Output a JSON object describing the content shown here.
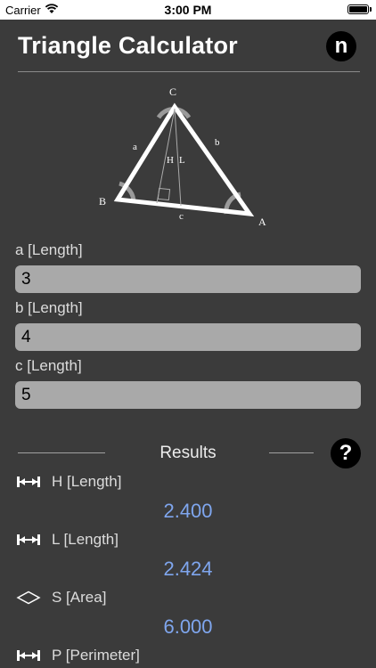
{
  "status_bar": {
    "carrier": "Carrier",
    "time": "3:00 PM"
  },
  "header": {
    "title": "Triangle Calculator",
    "info_button_label": "n"
  },
  "diagram": {
    "vertex_labels": {
      "a_vertex": "A",
      "b_vertex": "B",
      "c_vertex": "C"
    },
    "side_labels": {
      "a": "a",
      "b": "b",
      "c": "c"
    },
    "height_label": "H",
    "median_label": "L"
  },
  "inputs": [
    {
      "label": "a [Length]",
      "value": "3"
    },
    {
      "label": "b [Length]",
      "value": "4"
    },
    {
      "label": "c [Length]",
      "value": "5"
    }
  ],
  "results": {
    "title": "Results",
    "help_button_label": "?",
    "items": [
      {
        "label": "H [Length]",
        "value": "2.400",
        "icon": "length-icon"
      },
      {
        "label": "L [Length]",
        "value": "2.424",
        "icon": "length-icon"
      },
      {
        "label": "S [Area]",
        "value": "6.000",
        "icon": "area-icon"
      },
      {
        "label": "P [Perimeter]",
        "value": "",
        "icon": "length-icon"
      }
    ]
  },
  "colors": {
    "background": "#3b3b3b",
    "input_bg": "#a9a9a9",
    "value_blue": "#7fa6ee"
  }
}
